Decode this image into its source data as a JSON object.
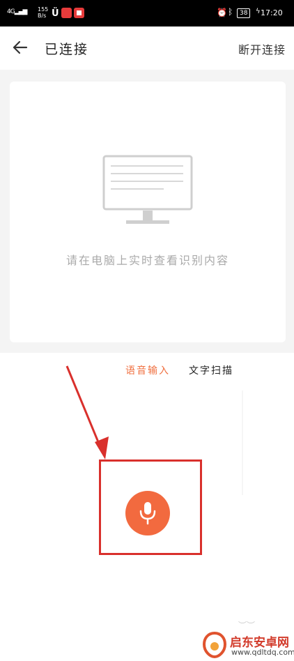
{
  "status_bar": {
    "signal": "4G",
    "net_speed": "155\nB/s",
    "battery": "38",
    "time": "17:20"
  },
  "header": {
    "title": "已连接",
    "action_label": "断开连接"
  },
  "preview": {
    "hint": "请在电脑上实时查看识别内容"
  },
  "tabs": [
    {
      "label": "语音输入",
      "active": true
    },
    {
      "label": "文字扫描",
      "active": false
    }
  ],
  "colors": {
    "accent": "#f26a3f",
    "annotation": "#d9302c"
  },
  "watermark": {
    "title": "启东安卓网",
    "url": "www.qdltdq.com"
  }
}
